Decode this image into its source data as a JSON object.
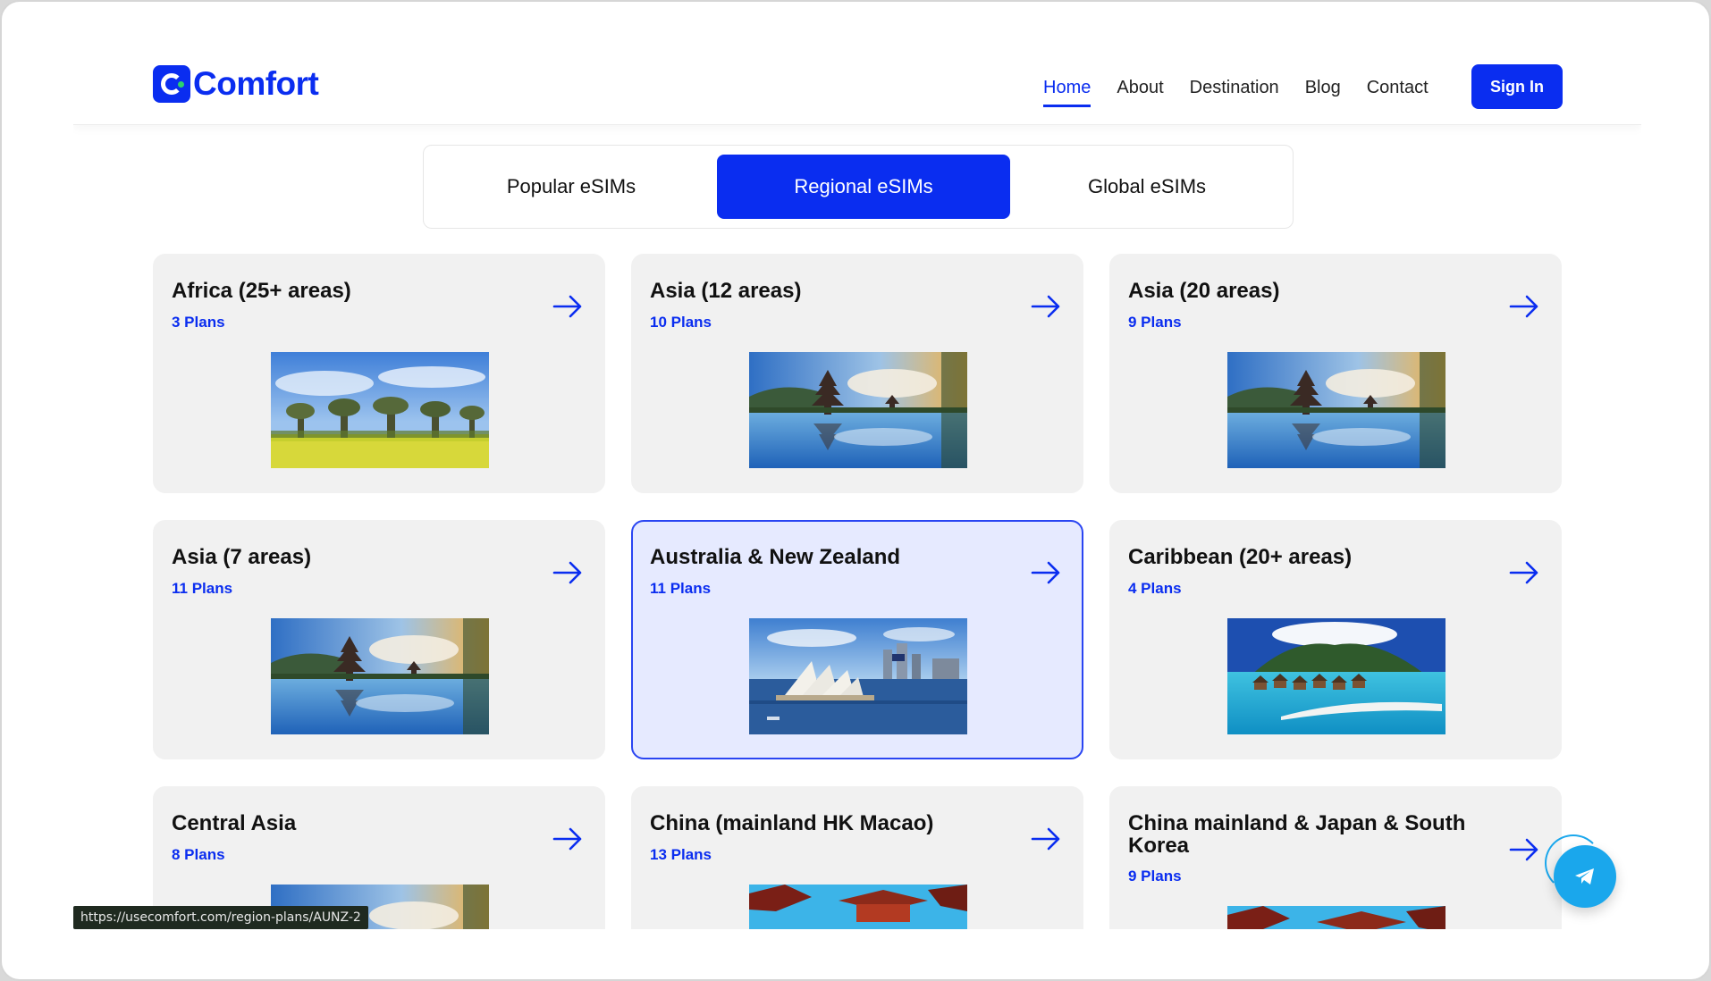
{
  "brand": {
    "name": "Comfort",
    "accent": "#0a2df0"
  },
  "nav": {
    "items": [
      "Home",
      "About",
      "Destination",
      "Blog",
      "Contact"
    ],
    "active": "Home",
    "signin_label": "Sign In"
  },
  "tabs": {
    "items": [
      "Popular eSIMs",
      "Regional eSIMs",
      "Global eSIMs"
    ],
    "active": "Regional eSIMs"
  },
  "cards": [
    {
      "title": "Africa (25+ areas)",
      "plans": "3 Plans",
      "image": "baobab-savanna"
    },
    {
      "title": "Asia (12 areas)",
      "plans": "10 Plans",
      "image": "bali-temple-lake"
    },
    {
      "title": "Asia (20 areas)",
      "plans": "9 Plans",
      "image": "bali-temple-lake"
    },
    {
      "title": "Asia (7 areas)",
      "plans": "11 Plans",
      "image": "bali-temple-lake"
    },
    {
      "title": "Australia & New Zealand",
      "plans": "11 Plans",
      "image": "sydney-opera-house",
      "highlighted": true
    },
    {
      "title": "Caribbean (20+ areas)",
      "plans": "4 Plans",
      "image": "overwater-bungalows"
    },
    {
      "title": "Central Asia",
      "plans": "8 Plans",
      "image": "bali-temple-lake"
    },
    {
      "title": "China (mainland HK Macao)",
      "plans": "13 Plans",
      "image": "chinese-pagoda"
    },
    {
      "title": "China mainland & Japan & South Korea",
      "plans": "9 Plans",
      "image": "chinese-pagoda"
    }
  ],
  "status_url": "https://usecomfort.com/region-plans/AUNZ-2",
  "icons": {
    "card_arrow": "arrow-right-icon",
    "fab": "telegram-icon"
  }
}
